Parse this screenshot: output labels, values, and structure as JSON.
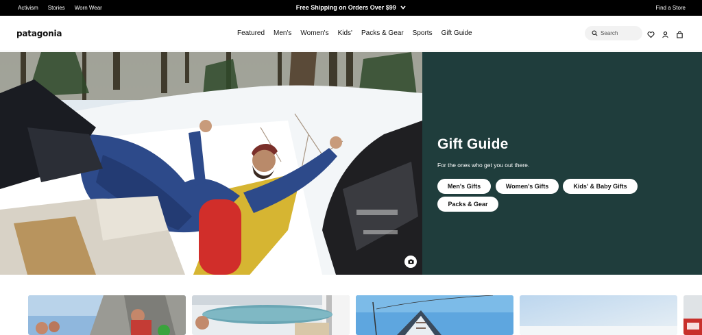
{
  "topbar": {
    "links": [
      "Activism",
      "Stories",
      "Worn Wear"
    ],
    "promo": "Free Shipping on Orders Over $99",
    "find_store": "Find a Store"
  },
  "header": {
    "logo": "patagonia",
    "nav": [
      "Featured",
      "Men's",
      "Women's",
      "Kids'",
      "Packs & Gear",
      "Sports",
      "Gift Guide"
    ],
    "search_placeholder": "Search"
  },
  "hero": {
    "title": "Gift Guide",
    "subtitle": "For the ones who get you out there.",
    "buttons": [
      "Men's Gifts",
      "Women's Gifts",
      "Kids' & Baby Gifts",
      "Packs & Gear"
    ],
    "panel_color": "#1f3d3c"
  },
  "icons": {
    "search": "search-icon",
    "wishlist": "heart-icon",
    "account": "user-icon",
    "cart": "bag-icon",
    "photo_credit": "camera-icon"
  }
}
